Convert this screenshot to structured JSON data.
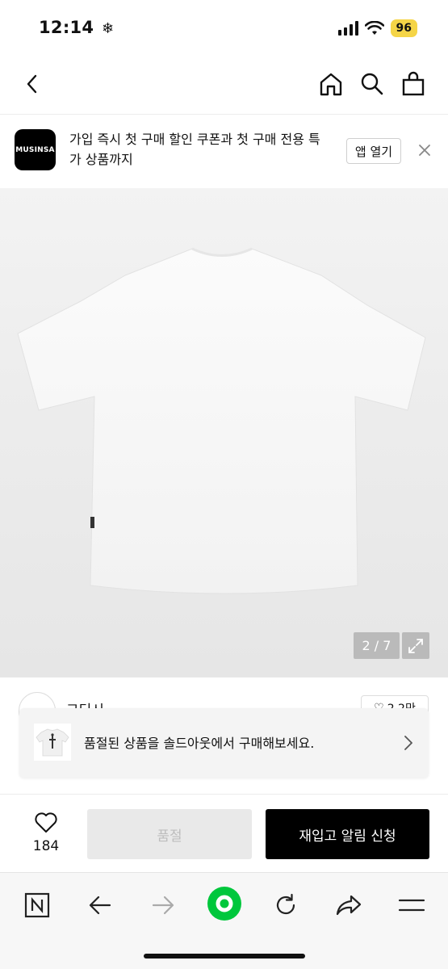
{
  "status_bar": {
    "time": "12:14",
    "battery": "96"
  },
  "app_banner": {
    "logo_text": "MUSINSA",
    "message": "가입 즉시 첫 구매 할인 쿠폰과 첫 구매 전용 특가 상품까지",
    "open_app_label": "앱 열기"
  },
  "product_image": {
    "counter": "2 / 7"
  },
  "brand": {
    "name": "그딘시",
    "like_count": "2.2만"
  },
  "toast": {
    "message": "품절된 상품을 솔드아웃에서 구매해보세요."
  },
  "purchase_bar": {
    "like_count": "184",
    "soldout_label": "품절",
    "restock_label": "재입고 알림 신청"
  },
  "colors": {
    "accent_green": "#00c73c",
    "battery_yellow": "#f5d547",
    "primary_black": "#000000"
  }
}
